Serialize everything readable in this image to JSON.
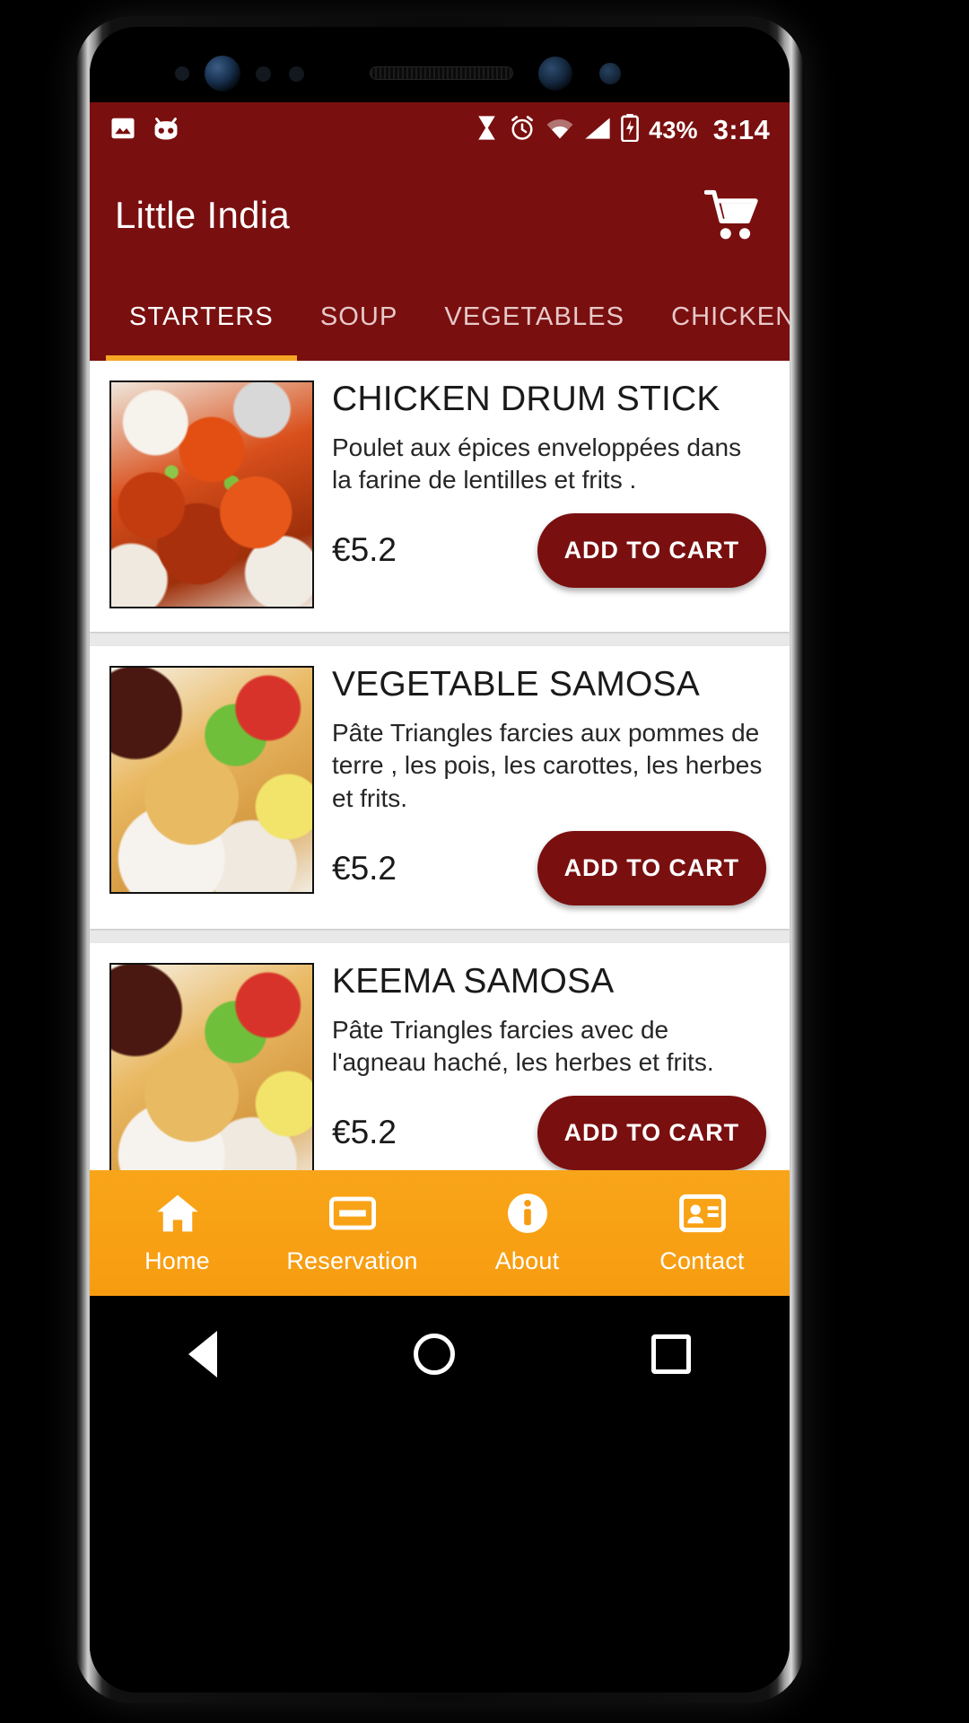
{
  "status_bar": {
    "icons_left": [
      "image-icon",
      "cyanogenmod-icon"
    ],
    "icons_right": [
      "hourglass-icon",
      "alarm-icon",
      "wifi-icon",
      "signal-icon",
      "battery-charging-icon"
    ],
    "battery_percent": "43%",
    "clock": "3:14"
  },
  "app_bar": {
    "title": "Little India",
    "cart_icon": "shopping-cart-icon"
  },
  "tabs": {
    "active_index": 0,
    "items": [
      {
        "label": "STARTERS"
      },
      {
        "label": "SOUP"
      },
      {
        "label": "VEGETABLES"
      },
      {
        "label": "CHICKEN"
      }
    ]
  },
  "menu": {
    "add_to_cart_label": "ADD TO CART",
    "items": [
      {
        "title": "CHICKEN DRUM STICK",
        "description": "Poulet aux épices enveloppées dans la farine de lentilles et frits .",
        "price": "€5.2",
        "thumb": "thumb-drumstick"
      },
      {
        "title": "VEGETABLE SAMOSA",
        "description": "Pâte Triangles farcies aux pommes de terre , les pois, les carottes, les herbes et frits.",
        "price": "€5.2",
        "thumb": "thumb-samosa"
      },
      {
        "title": "KEEMA SAMOSA",
        "description": "Pâte Triangles farcies avec de l'agneau haché, les herbes et frits.",
        "price": "€5.2",
        "thumb": "thumb-samosa"
      }
    ]
  },
  "bottom_nav": {
    "items": [
      {
        "label": "Home",
        "icon": "home-icon"
      },
      {
        "label": "Reservation",
        "icon": "reservation-card-icon"
      },
      {
        "label": "About",
        "icon": "info-icon"
      },
      {
        "label": "Contact",
        "icon": "contact-card-icon"
      }
    ]
  },
  "android_nav": {
    "back": "back-triangle-icon",
    "home": "home-circle-icon",
    "recents": "recents-square-icon"
  },
  "colors": {
    "brand_red": "#7a0f0f",
    "accent_orange": "#f9a519",
    "tab_indicator": "#f5a623"
  }
}
